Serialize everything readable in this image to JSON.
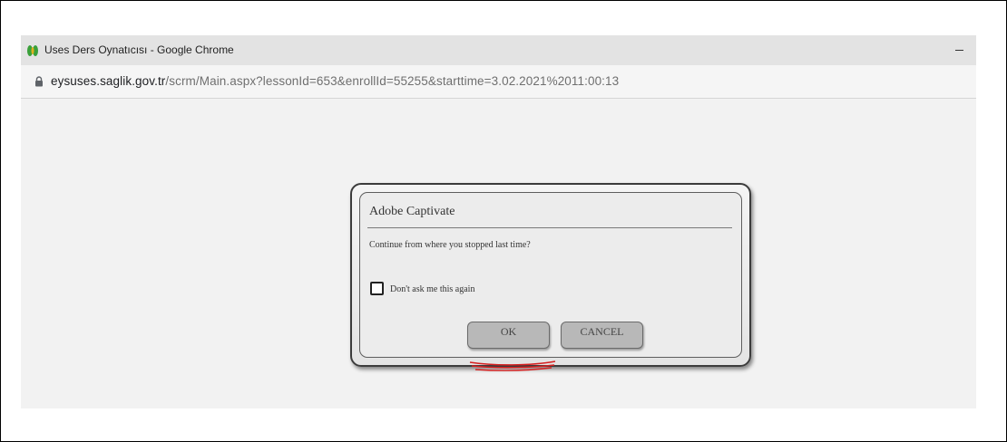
{
  "window": {
    "title": "Uses Ders Oynatıcısı - Google Chrome",
    "favicon": "uses-logo-icon",
    "minimize_icon": "minimize-icon"
  },
  "address_bar": {
    "lock_icon": "lock-icon",
    "domain": "eysuses.saglik.gov.tr",
    "path": "/scrm/Main.aspx?lessonId=653&enrollId=55255&starttime=3.02.2021%2011:00:13"
  },
  "dialog": {
    "title": "Adobe Captivate",
    "message": "Continue from where you stopped last time?",
    "checkbox_label": "Don't ask me this again",
    "checkbox_checked": false,
    "ok_label": "OK",
    "cancel_label": "CANCEL"
  },
  "annotation": {
    "color": "#d62020",
    "target": "ok-button"
  },
  "colors": {
    "favicon_green": "#3aa03a",
    "favicon_yellow": "#e0b020",
    "page_background": "#f2f2f2",
    "button_gray": "#b8b8b8"
  }
}
